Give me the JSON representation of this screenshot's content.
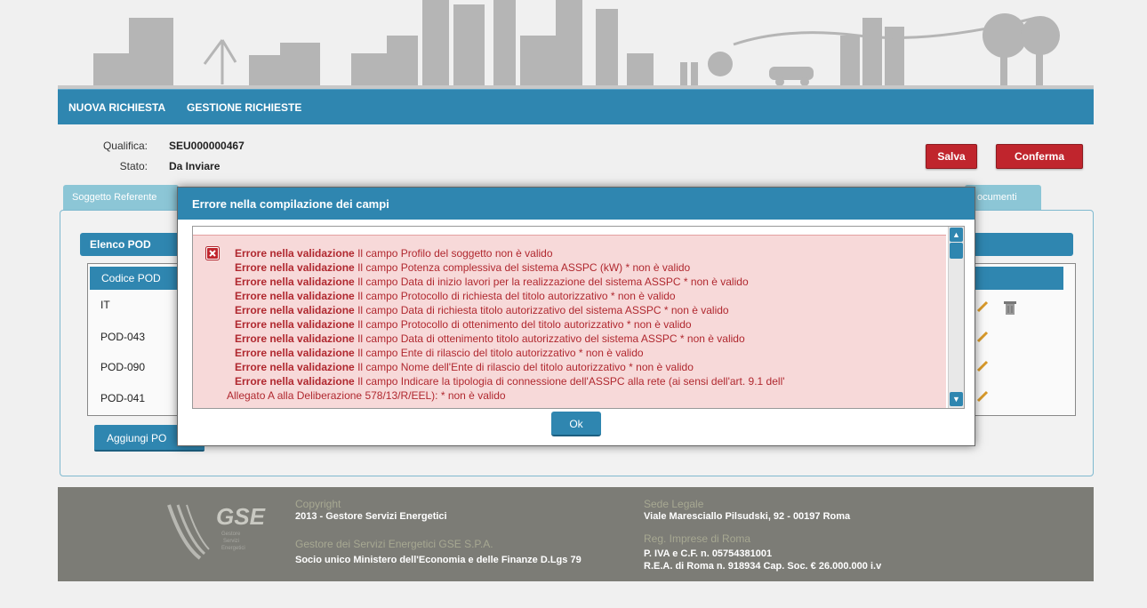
{
  "nav": {
    "items": [
      "NUOVA RICHIESTA",
      "GESTIONE RICHIESTE"
    ]
  },
  "info": {
    "qualifica_label": "Qualifica:",
    "qualifica_value": "SEU000000467",
    "stato_label": "Stato:",
    "stato_value": "Da Inviare"
  },
  "actions": {
    "save": "Salva",
    "confirm": "Conferma"
  },
  "tabs": {
    "first": "Soggetto Referente",
    "last": "ocumenti"
  },
  "pod": {
    "header": "Elenco POD",
    "column": "Codice POD",
    "rows": [
      "IT",
      "POD-043",
      "POD-090",
      "POD-041"
    ],
    "add_button": "Aggiungi PO"
  },
  "dialog": {
    "title": "Errore nella compilazione dei campi",
    "prefix": "Errore nella validazione",
    "errors": [
      "Il campo Profilo del soggetto non è valido",
      "Il campo Potenza complessiva del sistema ASSPC (kW) * non è valido",
      "Il campo Data di inizio lavori per la realizzazione del sistema ASSPC * non è valido",
      "Il campo Protocollo di richiesta del titolo autorizzativo * non è valido",
      "Il campo Data di richiesta titolo autorizzativo del sistema ASSPC * non è valido",
      "Il campo Protocollo di ottenimento del titolo autorizzativo * non è valido",
      "Il campo Data di ottenimento titolo autorizzativo del sistema ASSPC * non è valido",
      "Il campo Ente di rilascio del titolo autorizzativo * non è valido",
      "Il campo Nome dell'Ente di rilascio del titolo autorizzativo * non è valido",
      "Il campo Indicare la tipologia di connessione dell'ASSPC alla rete (ai sensi dell'art. 9.1 dell'"
    ],
    "wrap_line": "Allegato A alla Deliberazione 578/13/R/EEL): * non è valido",
    "ok": "Ok"
  },
  "footer": {
    "logo": "GSE",
    "logo_sub": [
      "Gestore",
      "Servizi",
      "Energetici"
    ],
    "copyright_label": "Copyright",
    "copyright_text": "2013 - Gestore Servizi Energetici",
    "company_label": "Gestore dei Servizi Energetici GSE S.P.A.",
    "company_text": "Socio unico Ministero dell'Economia e delle Finanze D.Lgs 79",
    "sede_label": "Sede Legale",
    "sede_text": "Viale Maresciallo Pilsudski, 92 - 00197 Roma",
    "reg_label": "Reg. Imprese di Roma",
    "reg_text1": "P. IVA e C.F. n. 05754381001",
    "reg_text2": "R.E.A. di Roma n. 918934 Cap. Soc. € 26.000.000 i.v"
  },
  "colors": {
    "primary": "#2f86b0",
    "danger": "#c0252d",
    "error_bg": "#f7d9d9",
    "error_text": "#b0282f"
  }
}
